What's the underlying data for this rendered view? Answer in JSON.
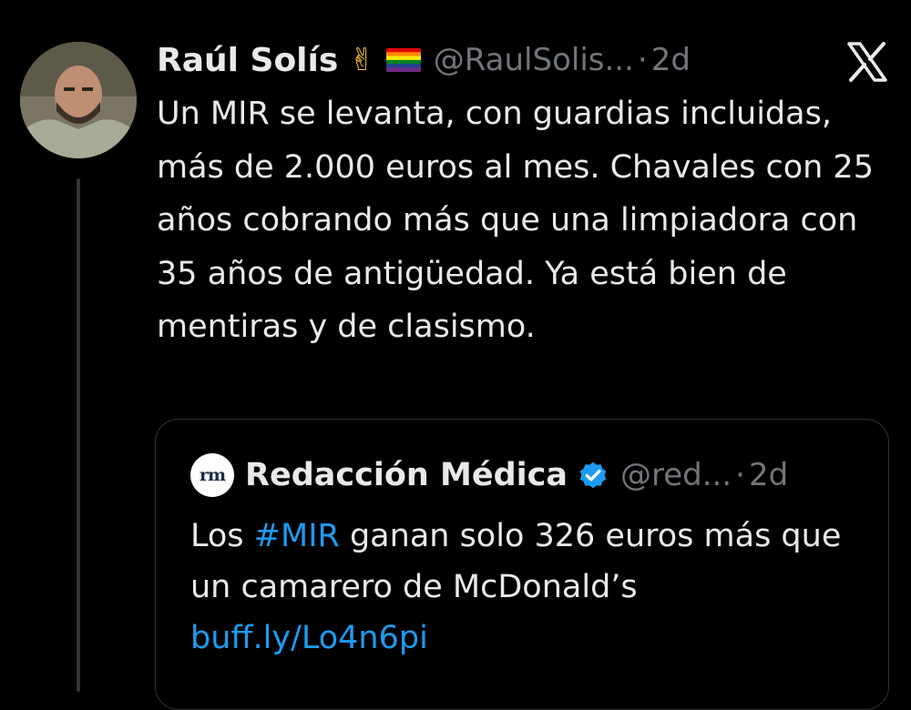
{
  "tweet": {
    "author": {
      "name": "Raúl Solís",
      "emoji_peace": "✌",
      "handle": "@RaulSolis...",
      "avatar_icon": "user-avatar"
    },
    "separator": "·",
    "time": "2d",
    "close_icon": "x-logo",
    "text": "Un MIR se levanta, con guardias incluidas, más de 2.000 euros al mes. Chavales con 25 años cobrando más que una limpiadora con 35 años de antigüedad. Ya está bien de mentiras y de clasismo.",
    "quote": {
      "logo_text": "rm",
      "name": "Redacción Médica",
      "handle": "@red...",
      "separator": "·",
      "time": "2d",
      "text_before": "Los ",
      "hashtag": "#MIR",
      "text_after": " ganan solo 326 euros más que un camarero de McDonald’s",
      "link": "buff.ly/Lo4n6pi"
    }
  },
  "colors": {
    "background": "#000000",
    "text_primary": "#e7e9ea",
    "text_secondary": "#71767b",
    "link": "#1d9bf0",
    "border": "#2f3336",
    "thread_line": "#333639"
  }
}
